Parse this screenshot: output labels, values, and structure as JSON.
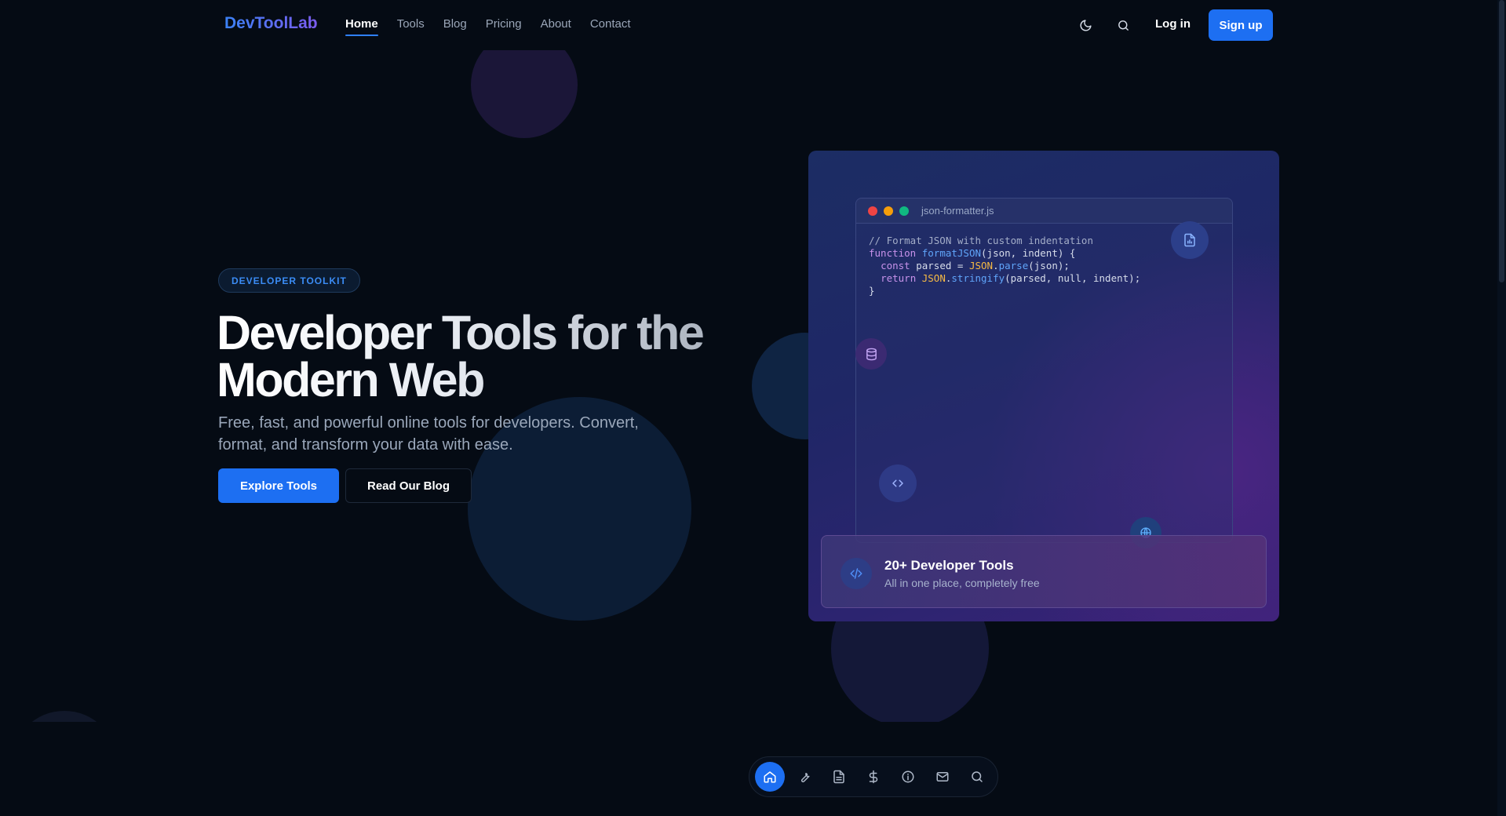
{
  "header": {
    "logo": "DevToolLab",
    "nav": [
      {
        "label": "Home",
        "active": true
      },
      {
        "label": "Tools",
        "active": false
      },
      {
        "label": "Blog",
        "active": false
      },
      {
        "label": "Pricing",
        "active": false
      },
      {
        "label": "About",
        "active": false
      },
      {
        "label": "Contact",
        "active": false
      }
    ],
    "theme_icon": "moon-icon",
    "search_icon": "search-icon",
    "login_label": "Log in",
    "signup_label": "Sign up"
  },
  "hero": {
    "badge": "DEVELOPER TOOLKIT",
    "title_line1": "Developer Tools for the",
    "title_line2": "Modern Web",
    "subtitle": "Free, fast, and powerful online tools for developers. Convert, format, and transform your data with ease.",
    "primary_cta": "Explore Tools",
    "secondary_cta": "Read Our Blog"
  },
  "editor": {
    "filename": "json-formatter.js",
    "code": {
      "comment": "// Format JSON with custom indentation",
      "kw_function": "function",
      "fn_name": "formatJSON",
      "params": "(json, indent) {",
      "kw_const": "const",
      "var_decl": " parsed = ",
      "obj_json": "JSON",
      "dot": ".",
      "fn_parse": "parse",
      "parse_args": "(json);",
      "kw_return": "return",
      "fn_stringify": "stringify",
      "stringify_args": "(parsed, null, indent);",
      "closing": "}"
    },
    "window_dots": [
      "#ef4444",
      "#f59e0b",
      "#10b981"
    ]
  },
  "stats": {
    "title": "20+ Developer Tools",
    "subtitle": "All in one place, completely free"
  },
  "floating_icons": [
    "file-chart-icon",
    "database-icon",
    "code-icon",
    "globe-icon"
  ],
  "dock": {
    "items": [
      "home-icon",
      "wrench-icon",
      "document-icon",
      "dollar-icon",
      "info-icon",
      "mail-icon",
      "search-icon"
    ],
    "active": "home-icon"
  },
  "colors": {
    "accent": "#1d6ff2",
    "background": "#050b14"
  }
}
